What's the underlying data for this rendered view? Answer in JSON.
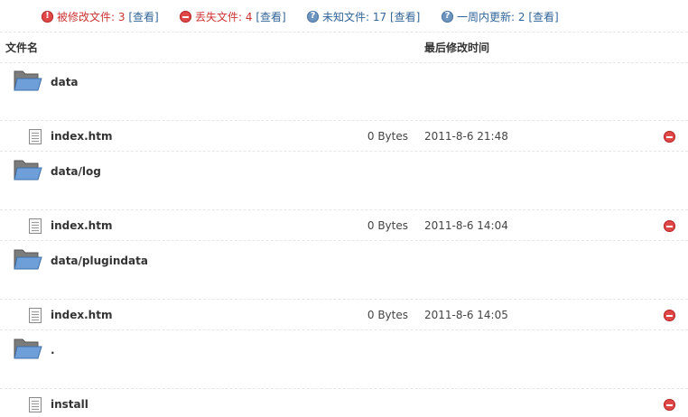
{
  "summary": {
    "modified": {
      "label": "被修改文件: 3",
      "link": "[查看]"
    },
    "missing": {
      "label": "丢失文件: 4",
      "link": "[查看]"
    },
    "unknown": {
      "label": "未知文件: 17",
      "link": "[查看]"
    },
    "recent": {
      "label": "一周内更新: 2",
      "link": "[查看]"
    }
  },
  "header": {
    "filename": "文件名",
    "modified_time": "最后修改时间"
  },
  "folders": [
    {
      "name": "data",
      "files": [
        {
          "name": "index.htm",
          "size": "0 Bytes",
          "time": "2011-8-6 21:48"
        }
      ]
    },
    {
      "name": "data/log",
      "files": [
        {
          "name": "index.htm",
          "size": "0 Bytes",
          "time": "2011-8-6 14:04"
        }
      ]
    },
    {
      "name": "data/plugindata",
      "files": [
        {
          "name": "index.htm",
          "size": "0 Bytes",
          "time": "2011-8-6 14:05"
        }
      ]
    },
    {
      "name": ".",
      "files": [
        {
          "name": "install",
          "size": "",
          "time": ""
        }
      ]
    }
  ],
  "icons": {
    "folder": "folder-icon",
    "file": "file-icon",
    "delete": "delete-icon",
    "warning": "warning-icon",
    "help": "help-icon"
  },
  "colors": {
    "red": "#cc3333",
    "blue": "#336699"
  }
}
